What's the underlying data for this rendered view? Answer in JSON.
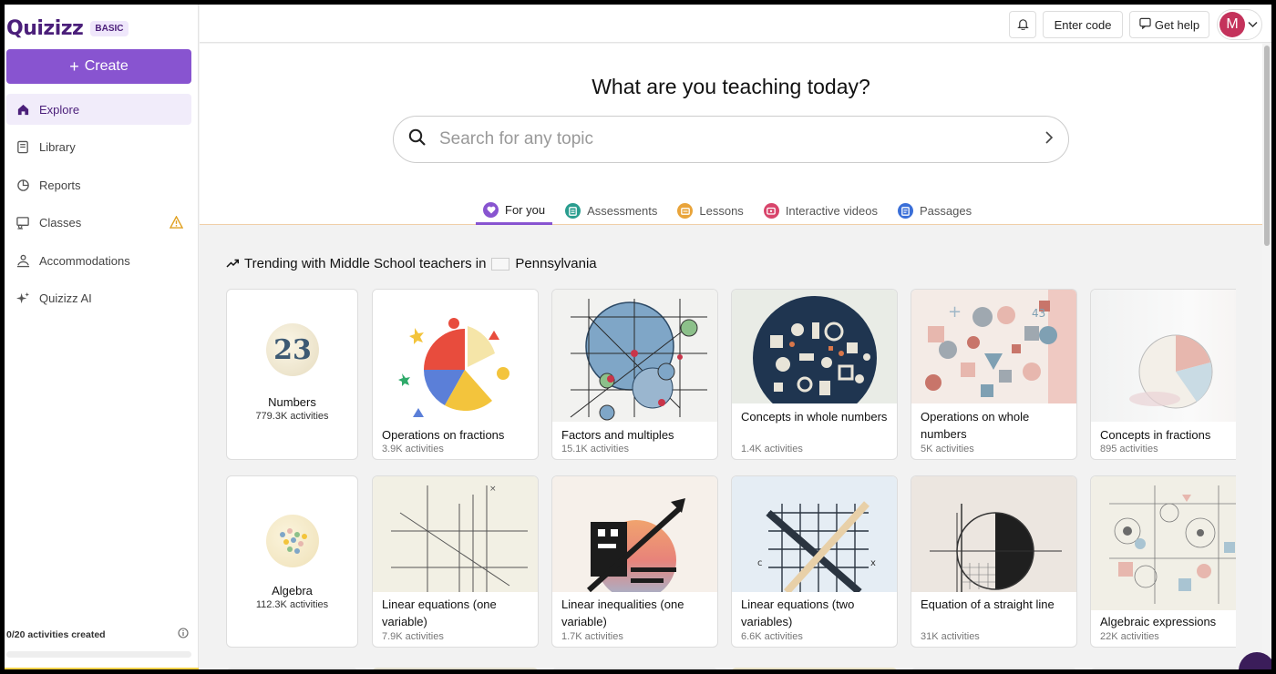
{
  "app": {
    "brand": "Quizizz",
    "plan_badge": "BASIC",
    "brand_color": "#4b1f7a",
    "accent_color": "#8854d0"
  },
  "sidebar": {
    "create_label": "Create",
    "items": [
      {
        "label": "Explore",
        "icon": "home-icon",
        "active": true
      },
      {
        "label": "Library",
        "icon": "library-icon"
      },
      {
        "label": "Reports",
        "icon": "reports-icon"
      },
      {
        "label": "Classes",
        "icon": "classes-icon",
        "warning": true
      },
      {
        "label": "Accommodations",
        "icon": "accommodations-icon"
      },
      {
        "label": "Quizizz AI",
        "icon": "sparkle-icon"
      }
    ],
    "quota_text": "0/20 activities created",
    "quota_progress": 0
  },
  "topbar": {
    "enter_code": "Enter code",
    "get_help": "Get help",
    "avatar_initial": "M"
  },
  "hero": {
    "title": "What are you teaching today?",
    "search_placeholder": "Search for any topic",
    "tabs": [
      {
        "label": "For you",
        "icon": "heart-icon",
        "color": "#8854d0",
        "active": true
      },
      {
        "label": "Assessments",
        "icon": "assessment-icon",
        "color": "#2a9d8f"
      },
      {
        "label": "Lessons",
        "icon": "lesson-icon",
        "color": "#e9a43a"
      },
      {
        "label": "Interactive videos",
        "icon": "video-icon",
        "color": "#d8456b"
      },
      {
        "label": "Passages",
        "icon": "passage-icon",
        "color": "#3a6fd8"
      }
    ]
  },
  "trending": {
    "prefix": "Trending with Middle School teachers in",
    "state": "Pennsylvania",
    "rows": [
      {
        "subject": {
          "name": "Numbers",
          "count": "779.3K activities"
        },
        "cards": [
          {
            "title": "Operations on fractions",
            "count": "3.9K activities"
          },
          {
            "title": "Factors and multiples",
            "count": "15.1K activities"
          },
          {
            "title": "Concepts in whole numbers",
            "count": "1.4K activities"
          },
          {
            "title": "Operations on whole numbers",
            "count": "5K activities"
          },
          {
            "title": "Concepts in fractions",
            "count": "895 activities"
          }
        ]
      },
      {
        "subject": {
          "name": "Algebra",
          "count": "112.3K activities"
        },
        "cards": [
          {
            "title": "Linear equations (one variable)",
            "count": "7.9K activities"
          },
          {
            "title": "Linear inequalities (one variable)",
            "count": "1.7K activities"
          },
          {
            "title": "Linear equations (two variables)",
            "count": "6.6K activities"
          },
          {
            "title": "Equation of a straight line",
            "count": "31K activities"
          },
          {
            "title": "Algebraic expressions",
            "count": "22K activities"
          }
        ]
      }
    ]
  }
}
